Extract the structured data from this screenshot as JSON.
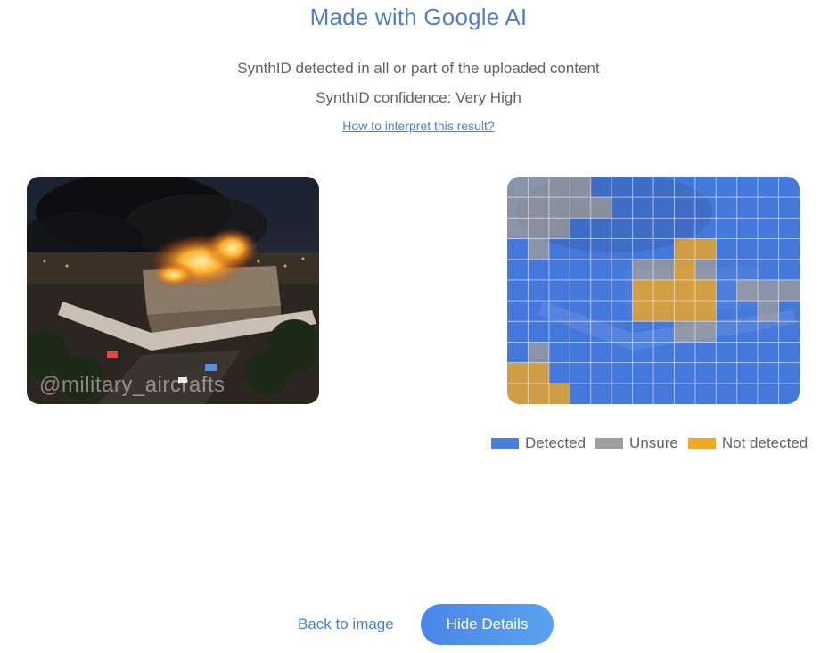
{
  "header": {
    "title": "Made with Google AI",
    "detected_message": "SynthID detected in all or part of the uploaded content",
    "confidence": "SynthID confidence: Very High",
    "interpret_link": "How to interpret this result?"
  },
  "images": {
    "photo_watermark": "@military_aircrafts"
  },
  "legend": [
    {
      "label": "Detected",
      "color": "#4a7fe0"
    },
    {
      "label": "Unsure",
      "color": "#9e9e9e"
    },
    {
      "label": "Not detected",
      "color": "#f2a922"
    }
  ],
  "heatmap": {
    "rows": 11,
    "cols": 14,
    "legend_key": {
      "D": "Detected",
      "U": "Unsure",
      "N": "Not detected"
    },
    "grid": [
      "UUUUDDDDDDDDDD",
      "UUUUUDDDDDDDDD",
      "UUUDDDDDDDDDDD",
      "DUDDDDDDNNDDDD",
      "DDDDDDUUNUDDDD",
      "DDDDDDNNNNDUUU",
      "DDDDDDNNNNDDUD",
      "DDDDDDDDUUDDDD",
      "DUDDDDDDDDDDDD",
      "NNDDDDDDDDDDDD",
      "NNNDDDDDDDDDDD"
    ]
  },
  "actions": {
    "back_label": "Back to image",
    "hide_label": "Hide Details"
  }
}
